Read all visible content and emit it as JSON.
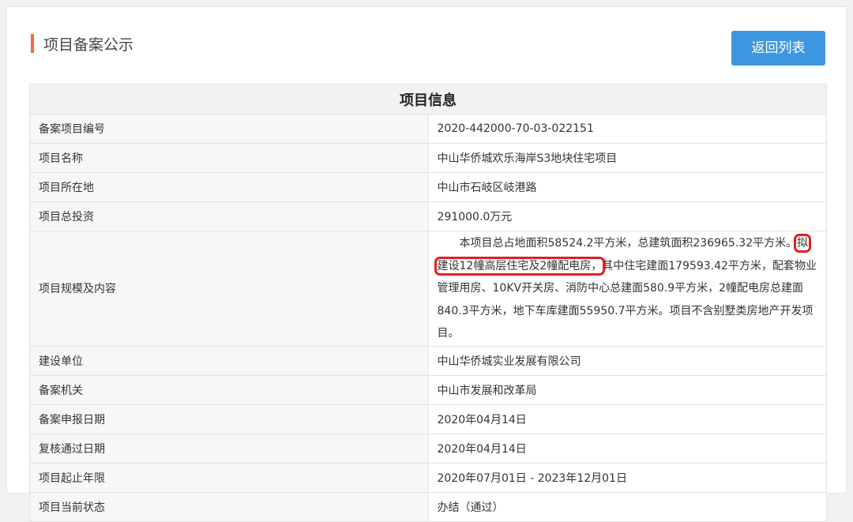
{
  "header": {
    "title": "项目备案公示",
    "back_button": "返回列表"
  },
  "table": {
    "title": "项目信息",
    "rows": [
      {
        "label": "备案项目编号",
        "value": "2020-442000-70-03-022151"
      },
      {
        "label": "项目名称",
        "value": "中山华侨城欢乐海岸S3地块住宅项目"
      },
      {
        "label": "项目所在地",
        "value": "中山市石岐区岐港路"
      },
      {
        "label": "项目总投资",
        "value": "291000.0万元"
      },
      {
        "label": "项目规模及内容",
        "value_before": "本项目总占地面积58524.2平方米，总建筑面积236965.32平方米。",
        "value_highlight": "拟建设12幢高层住宅及2幢配电房，",
        "value_after": "其中住宅建面179593.42平方米，配套物业管理用房、10KV开关房、消防中心总建面580.9平方米，2幢配电房总建面840.3平方米，地下车库建面55950.7平方米。项目不含别墅类房地产开发项目。"
      },
      {
        "label": "建设单位",
        "value": "中山华侨城实业发展有限公司"
      },
      {
        "label": "备案机关",
        "value": "中山市发展和改革局"
      },
      {
        "label": "备案申报日期",
        "value": "2020年04月14日"
      },
      {
        "label": "复核通过日期",
        "value": "2020年04月14日"
      },
      {
        "label": "项目起止年限",
        "value": "2020年07月01日 - 2023年12月01日"
      },
      {
        "label": "项目当前状态",
        "value": "办结（通过）"
      }
    ]
  },
  "colors": {
    "accent_bar": "#f26b3a",
    "button": "#3d97e0",
    "highlight_box": "#e0201e"
  }
}
